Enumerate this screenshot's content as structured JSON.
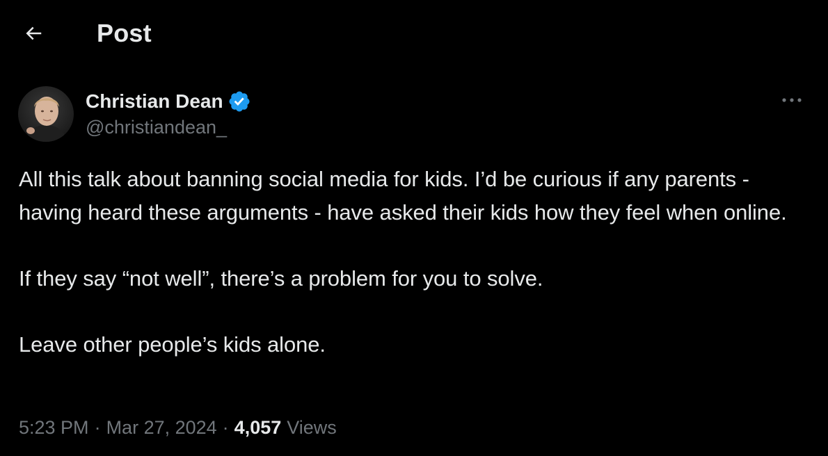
{
  "header": {
    "title": "Post",
    "back_icon": "arrow-left-icon"
  },
  "post": {
    "author": {
      "display_name": "Christian Dean",
      "handle": "@christiandean_",
      "verified": true,
      "verified_icon": "verified-badge-icon",
      "verified_color": "#1d9bf0"
    },
    "more_icon": "more-horizontal-icon",
    "text": "All this talk about banning social media for kids. I’d be curious if any parents - having heard these arguments - have asked their kids how they feel when online.\n\nIf they say “not well”, there’s a problem for you to solve.\n\nLeave other people’s kids alone.",
    "time": "5:23 PM",
    "date": "Mar 27, 2024",
    "separator": "·",
    "views_count": "4,057",
    "views_label": "Views"
  },
  "colors": {
    "background": "#000000",
    "primary_text": "#e7e9ea",
    "secondary_text": "#71767b",
    "accent": "#1d9bf0"
  }
}
